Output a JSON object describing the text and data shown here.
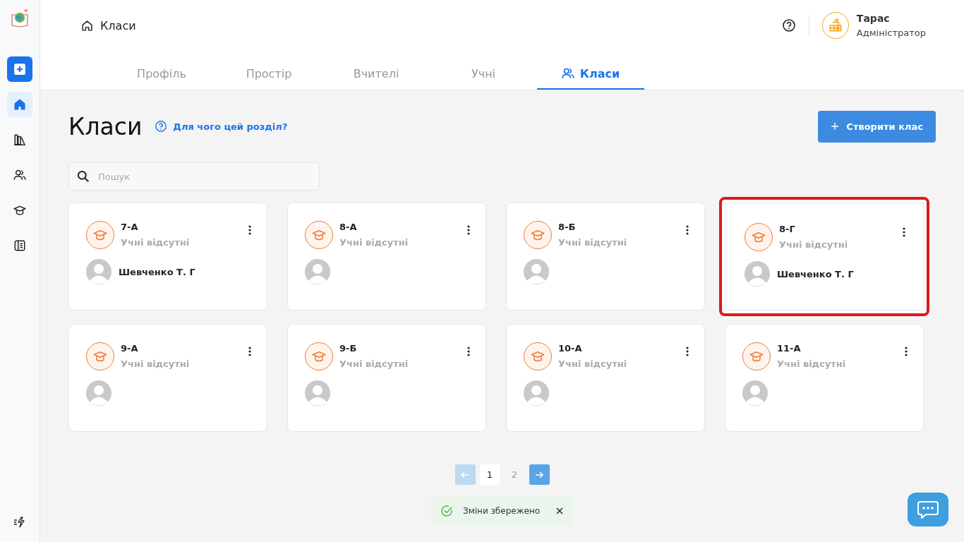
{
  "sidebar": {
    "items": [
      {
        "kind": "home",
        "selected": true
      },
      {
        "kind": "library",
        "selected": false
      },
      {
        "kind": "people",
        "selected": false
      },
      {
        "kind": "cap",
        "selected": false
      },
      {
        "kind": "journal",
        "selected": false
      }
    ],
    "bottom": {
      "kind": "bolt"
    }
  },
  "header": {
    "breadcrumb": "Класи",
    "user": {
      "name": "Тарас",
      "role": "Адміністратор"
    }
  },
  "tabs": [
    {
      "label": "Профіль",
      "selected": false
    },
    {
      "label": "Простір",
      "selected": false
    },
    {
      "label": "Вчителі",
      "selected": false
    },
    {
      "label": "Учні",
      "selected": false
    },
    {
      "label": "Класи",
      "selected": true
    }
  ],
  "page": {
    "title": "Класи",
    "help_link": "Для чого цей розділ?",
    "create_button": "Створити клас",
    "search": {
      "placeholder": "Пошук"
    }
  },
  "classes": [
    {
      "name": "7-А",
      "students": "Учні відсутні",
      "teacher": "Шевченко Т. Г",
      "highlighted": false
    },
    {
      "name": "8-А",
      "students": "Учні відсутні",
      "highlighted": false
    },
    {
      "name": "8-Б",
      "students": "Учні відсутні",
      "highlighted": false
    },
    {
      "name": "8-Г",
      "students": "Учні відсутні",
      "teacher": "Шевченко Т. Г",
      "highlighted": true
    },
    {
      "name": "9-А",
      "students": "Учні відсутні",
      "highlighted": false
    },
    {
      "name": "9-Б",
      "students": "Учні відсутні",
      "highlighted": false
    },
    {
      "name": "10-А",
      "students": "Учні відсутні",
      "highlighted": false
    },
    {
      "name": "11-А",
      "students": "Учні відсутні",
      "highlighted": false
    }
  ],
  "pagination": {
    "prev_disabled": true,
    "next_disabled": false,
    "pages": [
      {
        "label": "1",
        "selected": true
      },
      {
        "label": "2",
        "selected": false
      }
    ]
  },
  "toast": {
    "message": "Зміни збережено"
  }
}
